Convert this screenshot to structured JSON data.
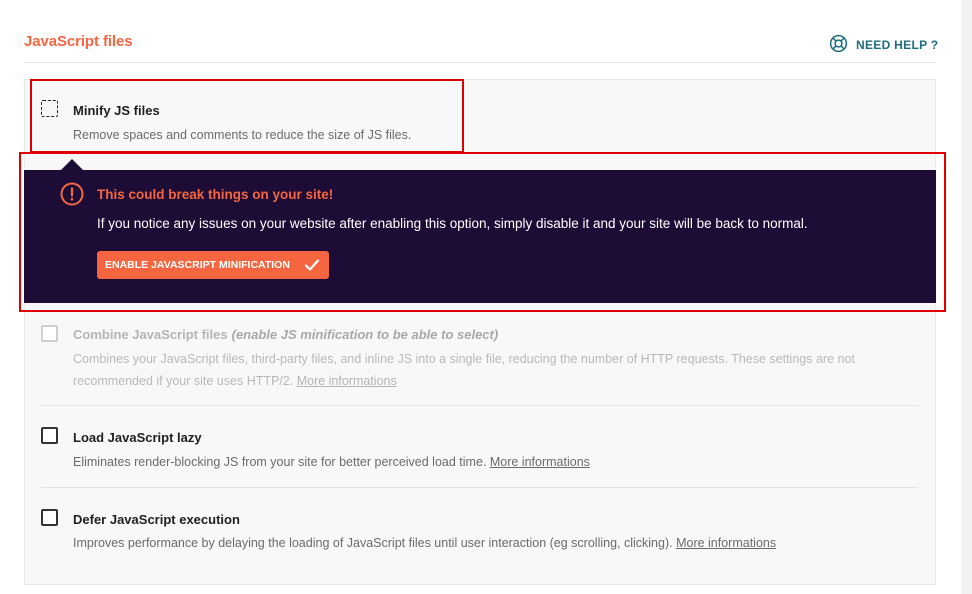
{
  "header": {
    "section_title": "JavaScript files",
    "help_label": "NEED HELP ?",
    "help_icon": "lifebuoy-icon"
  },
  "options": {
    "minify": {
      "title": "Minify JS files",
      "description": "Remove spaces and comments to reduce the size of JS files."
    },
    "combine": {
      "title": "Combine JavaScript files",
      "hint": "(enable JS minification to be able to select)",
      "description_line1": "Combines your JavaScript files, third-party files, and inline JS into a single file, reducing the number of HTTP requests. These settings are not",
      "description_line2": "recommended if your site uses HTTP/2. ",
      "link": "More informations"
    },
    "lazy": {
      "title": "Load JavaScript lazy",
      "description": "Eliminates render-blocking JS from your site for better perceived load time. ",
      "link": "More informations"
    },
    "defer": {
      "title": "Defer JavaScript execution",
      "description": "Improves performance by delaying the loading of JavaScript files until user interaction (eg scrolling, clicking). ",
      "link": "More informations"
    }
  },
  "warning": {
    "title": "This could break things on your site!",
    "text": "If you notice any issues on your website after enabling this option, simply disable it and your site will be back to normal.",
    "button_label": "ENABLE JAVASCRIPT MINIFICATION",
    "icon": "exclamation-circle-icon"
  },
  "colors": {
    "accent": "#f56640",
    "tooltip_bg": "#1c0c36",
    "help_teal": "#1e6d7e",
    "highlight_red": "#e00000"
  }
}
